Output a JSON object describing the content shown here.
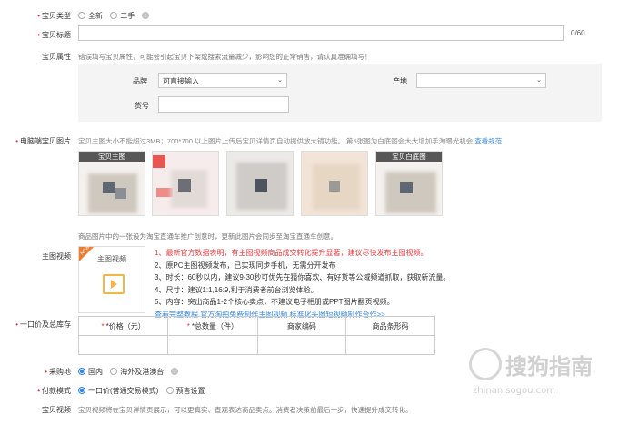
{
  "type_row": {
    "label": "宝贝类型",
    "options": [
      "全新",
      "二手"
    ]
  },
  "title_row": {
    "label": "宝贝标题",
    "counter": "0/60"
  },
  "attr_row": {
    "label": "宝贝属性",
    "hint": "错误填写宝贝属性，可能会引起宝贝下架或搜索流量减少，影响您的正常销售，请认真准确填写！",
    "brand_label": "品牌",
    "brand_placeholder": "可直接输入",
    "origin_label": "产地",
    "sku_label": "货号"
  },
  "pc_images": {
    "label": "电脑端宝贝图片",
    "hint": "宝贝主图大小不能超过3MB；700*700 以上图片上传后宝贝详情页自动提供放大镜功能。 第5张图为白底图会大大增加手淘曝光机会",
    "link": "查看规范",
    "thumb_main_caption": "宝贝主图",
    "thumb_white_caption": "宝贝白底图",
    "footer": "商品图片中的一张设为淘宝直通车推广创意时，更新此图片会同步至淘宝直通车创意。"
  },
  "main_video": {
    "label": "主图视频",
    "box_label": "主图视频",
    "badge": "NEW",
    "lines": [
      "1、最新官方数据表明，有主图视频商品成交转化提升显著，建议尽快发布主图视频。",
      "2、原PC主图视频发布，已实现同步手机，无需分开发布",
      "3、时长：60秒以内，建议9-30秒可优先在猜你喜欢、有好货等公域频道抓取，获取新流量。",
      "4、尺寸：建议1:1,16:9,利于消费者前台浏览体验。",
      "5、内容：突出商品1-2个核心卖点，不建议电子相册或PPT图片翻页视频。"
    ],
    "links": "查看完整教程  官方淘拍免费制作主图视频  标准化头图短视频制作合作>>"
  },
  "price_stock": {
    "label": "一口价及总库存",
    "headers": [
      "*价格（元）",
      "*总数量（件）",
      "商家编码",
      "商品条形码"
    ]
  },
  "purchase_row": {
    "label": "采购地",
    "options": [
      "国内",
      "海外及港澳台"
    ]
  },
  "pay_row": {
    "label": "付款模式",
    "options": [
      "一口价(普通交易模式)",
      "预售设置"
    ]
  },
  "video_row": {
    "label": "宝贝视频",
    "hint": "宝贝视频将在宝贝详情页展示，可以更真实、直观表达商品卖点。消费者决策前最后一步，快速提升成交转化。"
  },
  "watermark": {
    "text": "搜狗指南",
    "url": "zhinan.sogou.com"
  },
  "colors": {
    "accent": "#3a86d6",
    "required": "#e4393c",
    "warn": "#e4393c",
    "panel": "#f4f4f4"
  }
}
